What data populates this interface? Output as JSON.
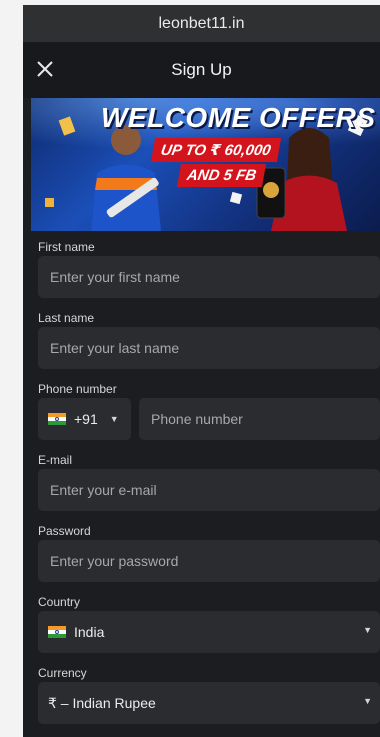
{
  "browser": {
    "url": "leonbet11.in"
  },
  "header": {
    "title": "Sign Up",
    "close_icon": "close-icon"
  },
  "banner": {
    "headline": "WELCOME OFFERS",
    "offer_line1": "UP TO ₹ 60,000",
    "offer_line2": "AND 5 FB"
  },
  "form": {
    "first_name": {
      "label": "First name",
      "placeholder": "Enter your first name"
    },
    "last_name": {
      "label": "Last name",
      "placeholder": "Enter your last name"
    },
    "phone": {
      "label": "Phone number",
      "country_code": "+91",
      "placeholder": "Phone number"
    },
    "email": {
      "label": "E-mail",
      "placeholder": "Enter your e-mail"
    },
    "password": {
      "label": "Password",
      "placeholder": "Enter your password"
    },
    "country": {
      "label": "Country",
      "value": "India"
    },
    "currency": {
      "label": "Currency",
      "value": "₹ – Indian Rupee"
    }
  },
  "colors": {
    "background": "#1b1d20",
    "input_bg": "#2a2c30",
    "offer_red": "#d4141c"
  }
}
